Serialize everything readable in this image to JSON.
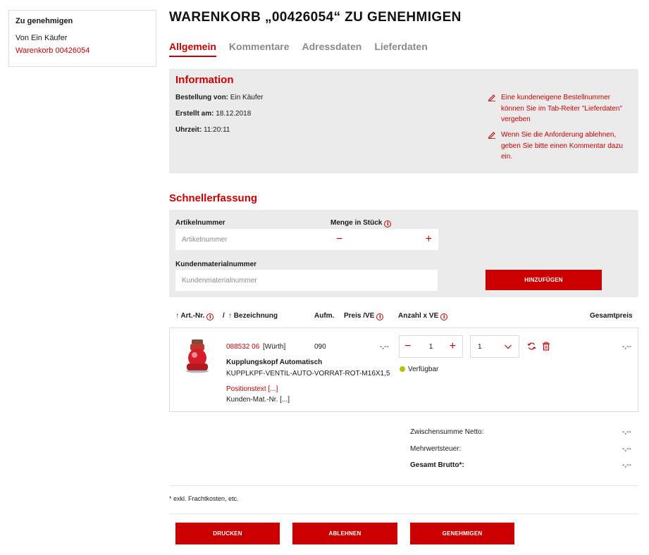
{
  "sidebar": {
    "title": "Zu genehmigen",
    "buyer": "Von Ein Käufer",
    "cart_link": "Warenkorb 00426054"
  },
  "page_title": "WARENKORB „00426054“ ZU GENEHMIGEN",
  "tabs": [
    {
      "label": "Allgemein",
      "active": true
    },
    {
      "label": "Kommentare",
      "active": false
    },
    {
      "label": "Adressdaten",
      "active": false
    },
    {
      "label": "Lieferdaten",
      "active": false
    }
  ],
  "info": {
    "heading": "Information",
    "ordered_by_label": "Bestellung von:",
    "ordered_by_value": "Ein Käufer",
    "created_label": "Erstellt am:",
    "created_value": "18.12.2018",
    "time_label": "Uhrzeit:",
    "time_value": "11:20:11",
    "notes": [
      "Eine kundeneigene Bestellnummer können Sie im Tab-Reiter \"Lieferdaten\" vergeben",
      "Wenn Sie die Anforderung ablehnen, geben Sie bitte einen Kommentar dazu ein."
    ]
  },
  "quick_entry": {
    "heading": "Schnellerfassung",
    "article_label": "Artikelnummer",
    "article_placeholder": "Artikelnummer",
    "qty_label": "Menge in Stück",
    "customer_mat_label": "Kundenmaterialnummer",
    "customer_mat_placeholder": "Kundenmaterialnummer",
    "add_button": "HINZUFÜGEN",
    "minus": "−",
    "plus": "+"
  },
  "table_header": {
    "art_nr": "Art.-Nr.",
    "slash": "/",
    "designation": "Bezeichnung",
    "aufm": "Aufm.",
    "price": "Preis /VE",
    "qty": "Anzahl x VE",
    "total": "Gesamtpreis"
  },
  "item": {
    "art_nr": "088532 06",
    "brand": "[Würth]",
    "aufm": "090",
    "price": "-,--",
    "name": "Kupplungskopf Automatisch",
    "spec": "KUPPLKPF-VENTIL-AUTO-VORRAT-ROT-M16X1,5",
    "position_text": "Positionstext [...]",
    "customer_mat": "Kunden-Mat.-Nr. [...]",
    "quantity": "1",
    "unit": "1",
    "availability": "Verfügbar",
    "total": "-,--"
  },
  "totals": {
    "subtotal_label": "Zwischensumme Netto:",
    "subtotal_value": "-,--",
    "vat_label": "Mehrwertsteuer:",
    "vat_value": "-,--",
    "gross_label": "Gesamt Brutto*:",
    "gross_value": "-,--"
  },
  "footnote": "* exkl. Frachtkosten, etc.",
  "actions": {
    "print": "DRUCKEN",
    "reject": "ABLEHNEN",
    "approve": "GENEHMIGEN"
  },
  "colors": {
    "accent": "#cc0000",
    "panel": "#ebebeb",
    "available": "#b5c400"
  }
}
